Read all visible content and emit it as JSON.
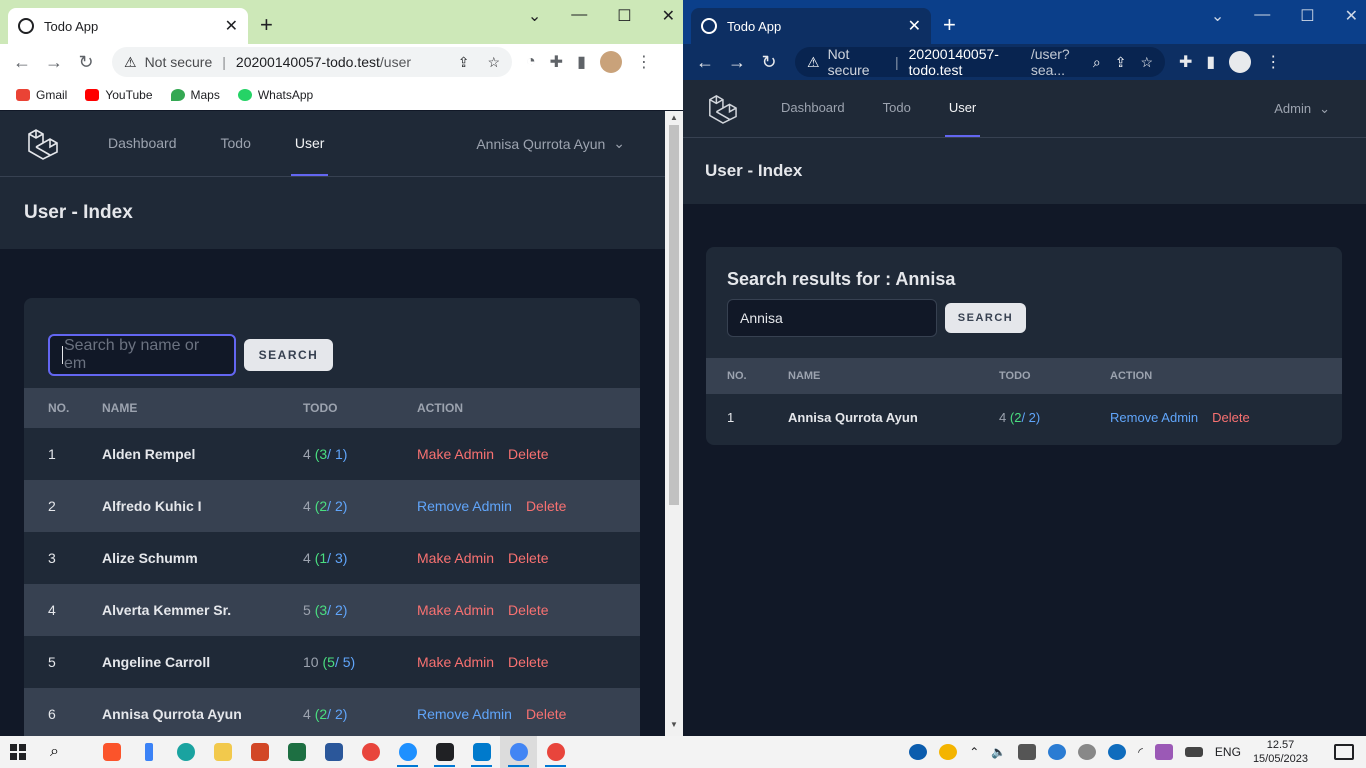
{
  "browsers": {
    "left": {
      "tab_title": "Todo App",
      "security": "Not secure",
      "url_host": "20200140057-todo.test",
      "url_path": "/user",
      "bookmarks": [
        "Gmail",
        "YouTube",
        "Maps",
        "WhatsApp"
      ]
    },
    "right": {
      "tab_title": "Todo App",
      "security": "Not secure",
      "url_host": "20200140057-todo.test",
      "url_path": "/user?sea..."
    }
  },
  "app": {
    "nav": [
      "Dashboard",
      "Todo",
      "User"
    ],
    "active_nav": "User",
    "header_title": "User - Index",
    "columns": [
      "NO.",
      "NAME",
      "TODO",
      "ACTION"
    ],
    "search_button": "SEARCH",
    "delete_label": "Delete",
    "make_admin_label": "Make Admin",
    "remove_admin_label": "Remove Admin"
  },
  "left_app": {
    "user_menu": "Annisa Qurrota Ayun",
    "search_placeholder": "Search by name or em",
    "rows": [
      {
        "no": "1",
        "name": "Alden Rempel",
        "total": "4",
        "done": "3",
        "undone": "1",
        "admin_action": "Make Admin"
      },
      {
        "no": "2",
        "name": "Alfredo Kuhic I",
        "total": "4",
        "done": "2",
        "undone": "2",
        "admin_action": "Remove Admin"
      },
      {
        "no": "3",
        "name": "Alize Schumm",
        "total": "4",
        "done": "1",
        "undone": "3",
        "admin_action": "Make Admin"
      },
      {
        "no": "4",
        "name": "Alverta Kemmer Sr.",
        "total": "5",
        "done": "3",
        "undone": "2",
        "admin_action": "Make Admin"
      },
      {
        "no": "5",
        "name": "Angeline Carroll",
        "total": "10",
        "done": "5",
        "undone": "5",
        "admin_action": "Make Admin"
      },
      {
        "no": "6",
        "name": "Annisa Qurrota Ayun",
        "total": "4",
        "done": "2",
        "undone": "2",
        "admin_action": "Remove Admin"
      }
    ]
  },
  "right_app": {
    "user_menu": "Admin",
    "results_title": "Search results for : Annisa",
    "search_value": "Annisa",
    "rows": [
      {
        "no": "1",
        "name": "Annisa Qurrota Ayun",
        "total": "4",
        "done": "2",
        "undone": "2",
        "admin_action": "Remove Admin"
      }
    ]
  },
  "taskbar": {
    "lang": "ENG",
    "time": "12.57",
    "date": "15/05/2023"
  },
  "colors": {
    "accent": "#6366f1",
    "done": "#4ade80",
    "undone": "#60a5fa",
    "danger": "#f87171",
    "panel": "#1f2937",
    "bg": "#111827"
  }
}
